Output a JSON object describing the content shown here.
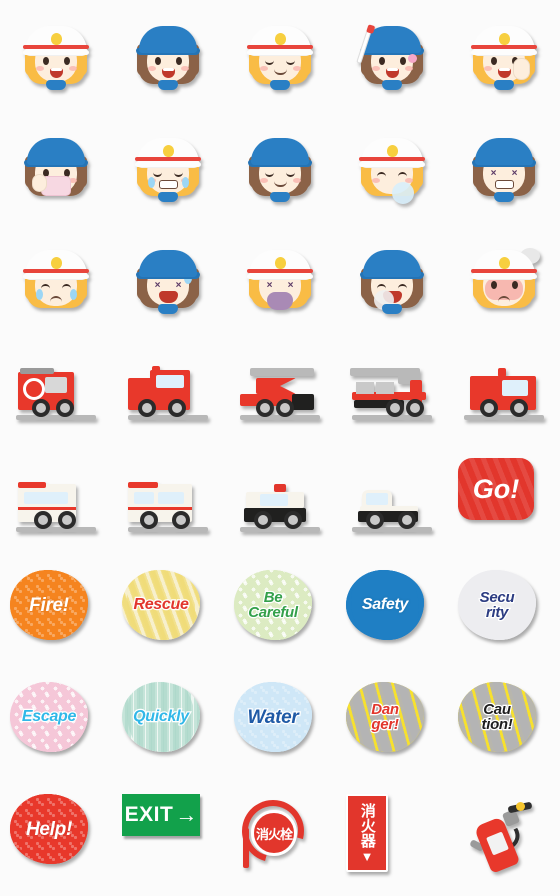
{
  "sheet": {
    "title": "Firefighter Girl & Fire Safety Emoji Sticker Sheet",
    "background_color": "#fbfbfb",
    "columns": 5,
    "rows": 8,
    "cell_size_px": 112,
    "total_stickers": 40
  },
  "palette": {
    "fire_red": "#e8382b",
    "sign_red": "#e2362c",
    "cap_blue": "#2a7fc4",
    "helmet_white": "#fdfdfd",
    "helmet_badge_yellow": "#f7cf3f",
    "hair_blonde": "#f9bc45",
    "hair_brown": "#8b6247",
    "skin": "#fdeedd",
    "exit_green": "#12a14b",
    "window_blue": "#dff0fb",
    "ambulance_cream": "#f7f4ec",
    "tire_black": "#2b2b2b",
    "ground_gray": "#b8b8b8"
  },
  "stickers": [
    {
      "id": "r1c1",
      "row": 1,
      "col": 1,
      "kind": "character",
      "name": "firefighter-girl-smiling",
      "label": "Smiling firefighter girl in white helmet",
      "headwear": "white-helmet",
      "hair": "blonde",
      "expression": "open-smile"
    },
    {
      "id": "r1c2",
      "row": 1,
      "col": 2,
      "kind": "character",
      "name": "cap-girl-smiling",
      "label": "Smiling girl in blue cap",
      "headwear": "blue-cap",
      "hair": "brown",
      "expression": "open-smile"
    },
    {
      "id": "r1c3",
      "row": 1,
      "col": 3,
      "kind": "character",
      "name": "firefighter-girl-happy-eyes",
      "label": "Firefighter girl with happy closed eyes",
      "headwear": "white-helmet",
      "hair": "blonde",
      "expression": "happy-eyes"
    },
    {
      "id": "r1c4",
      "row": 1,
      "col": 4,
      "kind": "character",
      "name": "cap-girl-with-baton",
      "label": "Girl in blue cap holding a baton",
      "headwear": "blue-cap",
      "hair": "brown",
      "expression": "open-smile",
      "prop": "baton"
    },
    {
      "id": "r1c5",
      "row": 1,
      "col": 5,
      "kind": "character",
      "name": "firefighter-girl-pointing-up",
      "label": "Firefighter girl pointing up",
      "headwear": "white-helmet",
      "hair": "blonde",
      "expression": "open-smile",
      "prop": "pointing-hand"
    },
    {
      "id": "r2c1",
      "row": 2,
      "col": 1,
      "kind": "character",
      "name": "cap-girl-with-mask",
      "label": "Girl in blue cap wearing a pink face mask",
      "headwear": "blue-cap",
      "hair": "brown",
      "expression": "masked"
    },
    {
      "id": "r2c2",
      "row": 2,
      "col": 2,
      "kind": "character",
      "name": "firefighter-girl-laughing-tears",
      "label": "Firefighter girl laughing with tears",
      "headwear": "white-helmet",
      "hair": "blonde",
      "expression": "laughing-tears"
    },
    {
      "id": "r2c3",
      "row": 2,
      "col": 3,
      "kind": "character",
      "name": "cap-girl-blushing",
      "label": "Girl in blue cap blushing with closed eyes",
      "headwear": "blue-cap",
      "hair": "brown",
      "expression": "happy-eyes"
    },
    {
      "id": "r2c4",
      "row": 2,
      "col": 4,
      "kind": "character",
      "name": "firefighter-girl-sleeping",
      "label": "Firefighter girl sleeping with bubble",
      "headwear": "white-helmet",
      "hair": "blonde",
      "expression": "sleeping"
    },
    {
      "id": "r2c5",
      "row": 2,
      "col": 5,
      "kind": "character",
      "name": "cap-girl-gritting-teeth",
      "label": "Girl in blue cap gritting teeth",
      "headwear": "blue-cap",
      "hair": "brown",
      "expression": "gritting-teeth"
    },
    {
      "id": "r3c1",
      "row": 3,
      "col": 1,
      "kind": "character",
      "name": "firefighter-girl-crying",
      "label": "Firefighter girl crying",
      "headwear": "white-helmet",
      "hair": "blonde",
      "expression": "crying"
    },
    {
      "id": "r3c2",
      "row": 3,
      "col": 2,
      "kind": "character",
      "name": "cap-girl-distressed",
      "label": "Girl in blue cap distressed with sweat drop",
      "headwear": "blue-cap",
      "hair": "brown",
      "expression": "distressed"
    },
    {
      "id": "r3c3",
      "row": 3,
      "col": 3,
      "kind": "character",
      "name": "firefighter-girl-sick",
      "label": "Firefighter girl feeling sick with X eyes",
      "headwear": "white-helmet",
      "hair": "blonde",
      "expression": "sick"
    },
    {
      "id": "r3c4",
      "row": 3,
      "col": 4,
      "kind": "character",
      "name": "cap-girl-yawning",
      "label": "Girl in blue cap yawning",
      "headwear": "blue-cap",
      "hair": "brown",
      "expression": "yawning"
    },
    {
      "id": "r3c5",
      "row": 3,
      "col": 5,
      "kind": "character",
      "name": "firefighter-girl-angry",
      "label": "Firefighter girl angry with steam",
      "headwear": "white-helmet",
      "hair": "blonde",
      "expression": "angry"
    },
    {
      "id": "r4c1",
      "row": 4,
      "col": 1,
      "kind": "vehicle",
      "name": "fire-engine-rear-hose",
      "label": "Fire engine rear view with hose reel"
    },
    {
      "id": "r4c2",
      "row": 4,
      "col": 2,
      "kind": "vehicle",
      "name": "fire-engine-side",
      "label": "Fire engine side view"
    },
    {
      "id": "r4c3",
      "row": 4,
      "col": 3,
      "kind": "vehicle",
      "name": "fire-truck-snorkel",
      "label": "Fire truck with articulated snorkel boom"
    },
    {
      "id": "r4c4",
      "row": 4,
      "col": 4,
      "kind": "vehicle",
      "name": "fire-truck-aerial-ladder",
      "label": "Aerial ladder fire truck with platform"
    },
    {
      "id": "r4c5",
      "row": 4,
      "col": 5,
      "kind": "vehicle",
      "name": "fire-engine-front",
      "label": "Fire engine facing right"
    },
    {
      "id": "r5c1",
      "row": 5,
      "col": 1,
      "kind": "vehicle",
      "name": "ambulance-rear",
      "label": "Ambulance rear view"
    },
    {
      "id": "r5c2",
      "row": 5,
      "col": 2,
      "kind": "vehicle",
      "name": "ambulance-side",
      "label": "Ambulance side view"
    },
    {
      "id": "r5c3",
      "row": 5,
      "col": 3,
      "kind": "vehicle",
      "name": "police-car",
      "label": "Police car with roof light"
    },
    {
      "id": "r5c4",
      "row": 5,
      "col": 4,
      "kind": "vehicle",
      "name": "pickup-truck",
      "label": "Pickup truck"
    },
    {
      "id": "r5c5",
      "row": 5,
      "col": 5,
      "kind": "badge-square",
      "name": "badge-go",
      "text": "Go!",
      "label": "Go! badge",
      "bg": "#e2362c",
      "fg": "#ffffff",
      "pattern": "diagonal-stripes"
    },
    {
      "id": "r6c1",
      "row": 6,
      "col": 1,
      "kind": "badge",
      "name": "badge-fire",
      "text": "Fire!",
      "bg": "#f5841f",
      "fg": "#ffffff",
      "pattern": "dots"
    },
    {
      "id": "r6c2",
      "row": 6,
      "col": 2,
      "kind": "badge",
      "name": "badge-rescue",
      "text": "Rescue",
      "bg": "#f7f0cd",
      "fg": "#e2362c",
      "pattern": "diagonal-stripes"
    },
    {
      "id": "r6c3",
      "row": 6,
      "col": 3,
      "kind": "badge",
      "name": "badge-be-careful",
      "text": "Be Careful",
      "line1": "Be",
      "line2": "Careful",
      "bg": "#dcebc2",
      "fg": "#34a04a",
      "pattern": "stars"
    },
    {
      "id": "r6c4",
      "row": 6,
      "col": 4,
      "kind": "badge",
      "name": "badge-safety",
      "text": "Safety",
      "bg": "#1f7fc4",
      "fg": "#ffffff",
      "pattern": "plain"
    },
    {
      "id": "r6c5",
      "row": 6,
      "col": 5,
      "kind": "badge",
      "name": "badge-security",
      "text": "Security",
      "line1": "Secu",
      "line2": "rity",
      "bg": "#ededf0",
      "fg": "#2c3c82",
      "pattern": "plain"
    },
    {
      "id": "r7c1",
      "row": 7,
      "col": 1,
      "kind": "badge",
      "name": "badge-escape",
      "text": "Escape",
      "bg": "#f5c7d8",
      "fg": "#31b8e8",
      "pattern": "stars"
    },
    {
      "id": "r7c2",
      "row": 7,
      "col": 2,
      "kind": "badge",
      "name": "badge-quickly",
      "text": "Quickly",
      "bg": "#eef7f2",
      "fg": "#31b8e8",
      "pattern": "vertical-stripes"
    },
    {
      "id": "r7c3",
      "row": 7,
      "col": 3,
      "kind": "badge",
      "name": "badge-water",
      "text": "Water",
      "bg": "#cfe7f7",
      "fg": "#1f5aa6",
      "pattern": "dots"
    },
    {
      "id": "r7c4",
      "row": 7,
      "col": 4,
      "kind": "badge",
      "name": "badge-danger",
      "text": "Danger!",
      "line1": "Dan",
      "line2": "ger!",
      "bg": "#f7e12e",
      "fg": "#e2362c",
      "pattern": "caution-stripes"
    },
    {
      "id": "r7c5",
      "row": 7,
      "col": 5,
      "kind": "badge",
      "name": "badge-caution",
      "text": "Caution!",
      "line1": "Cau",
      "line2": "tion!",
      "bg": "#f7e12e",
      "fg": "#1e1e1e",
      "pattern": "caution-stripes"
    },
    {
      "id": "r8c1",
      "row": 8,
      "col": 1,
      "kind": "badge",
      "name": "badge-help",
      "text": "Help!",
      "bg": "#e8382b",
      "fg": "#ffffff",
      "pattern": "dots"
    },
    {
      "id": "r8c2",
      "row": 8,
      "col": 2,
      "kind": "sign",
      "name": "exit-sign",
      "text": "EXIT",
      "arrow": "→",
      "bg": "#12a14b",
      "fg": "#ffffff",
      "label": "Green EXIT sign with right arrow"
    },
    {
      "id": "r8c3",
      "row": 8,
      "col": 3,
      "kind": "sign",
      "name": "fire-hydrant-sign",
      "text": "消火栓",
      "bg": "#e2362c",
      "fg": "#ffffff",
      "label": "Japanese fire hydrant sign"
    },
    {
      "id": "r8c4",
      "row": 8,
      "col": 4,
      "kind": "sign",
      "name": "fire-extinguisher-sign",
      "text": "消火器",
      "arrow": "▼",
      "bg": "#e2362c",
      "fg": "#ffffff",
      "label": "Japanese fire extinguisher sign with down arrow"
    },
    {
      "id": "r8c5",
      "row": 8,
      "col": 5,
      "kind": "object",
      "name": "fire-extinguisher",
      "label": "Red fire extinguisher with black hose"
    }
  ]
}
